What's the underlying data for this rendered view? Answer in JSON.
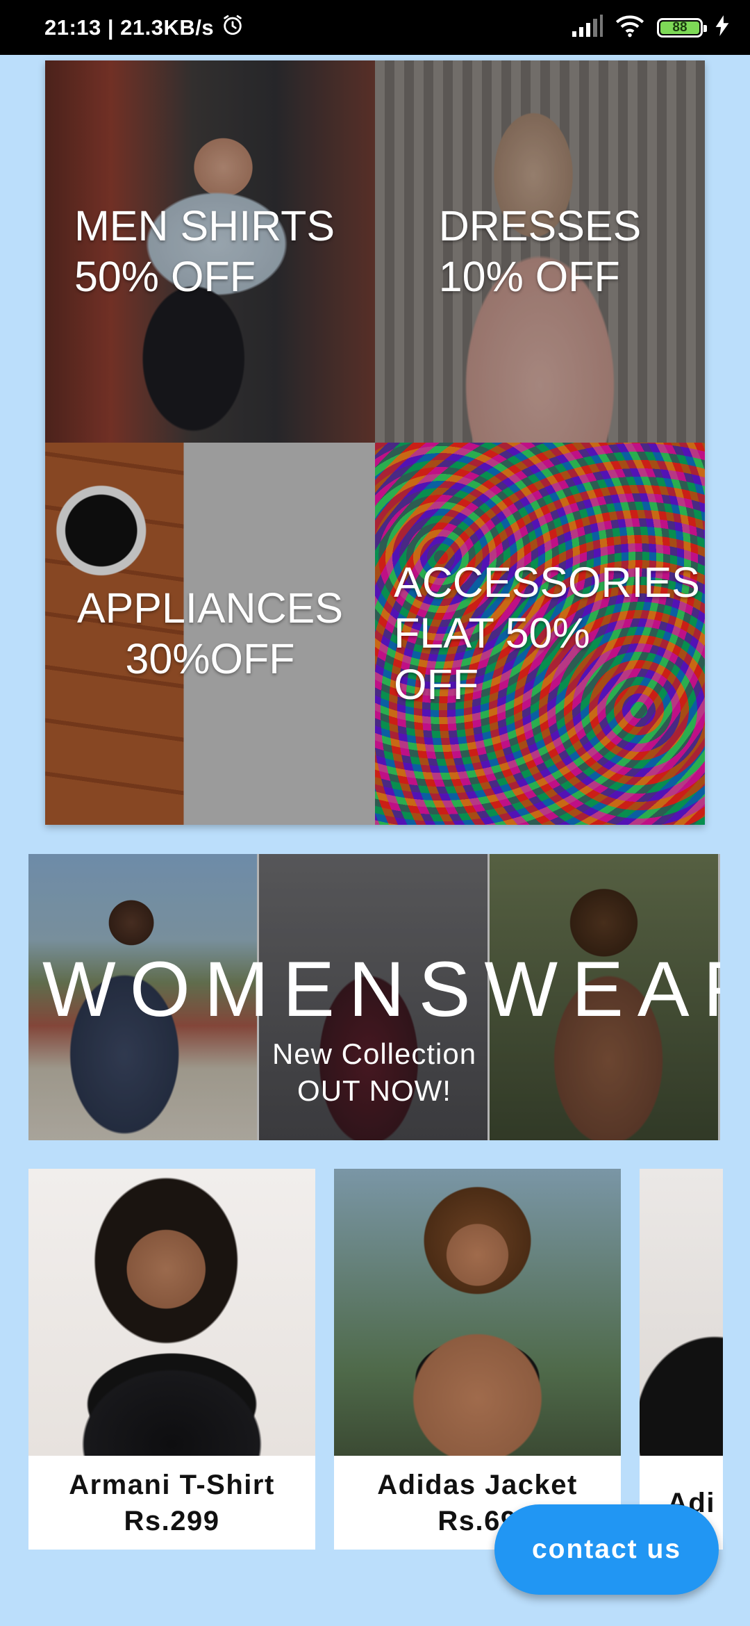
{
  "status_bar": {
    "time_speed": "21:13 | 21.3KB/s",
    "battery": "88",
    "icons": [
      "alarm-icon",
      "signal-icon",
      "wifi-icon",
      "battery-icon",
      "charging-icon"
    ]
  },
  "categories": [
    {
      "label": "MEN SHIRTS\n50% OFF"
    },
    {
      "label": "DRESSES\n10% OFF"
    },
    {
      "label": "APPLIANCES\n30%OFF"
    },
    {
      "label": "ACCESSORIES\nFLAT 50%\nOFF"
    }
  ],
  "banner": {
    "title": "WOMENSWEAR",
    "subtitle": "New Collection\nOUT NOW!"
  },
  "products": [
    {
      "name": "Armani T-Shirt",
      "price": "Rs.299"
    },
    {
      "name": "Adidas Jacket",
      "price": "Rs.69"
    },
    {
      "name": "Adi",
      "price": ""
    }
  ],
  "fab": {
    "label": "contact us"
  },
  "colors": {
    "background": "#bbdefb",
    "fab": "#2196f3"
  }
}
